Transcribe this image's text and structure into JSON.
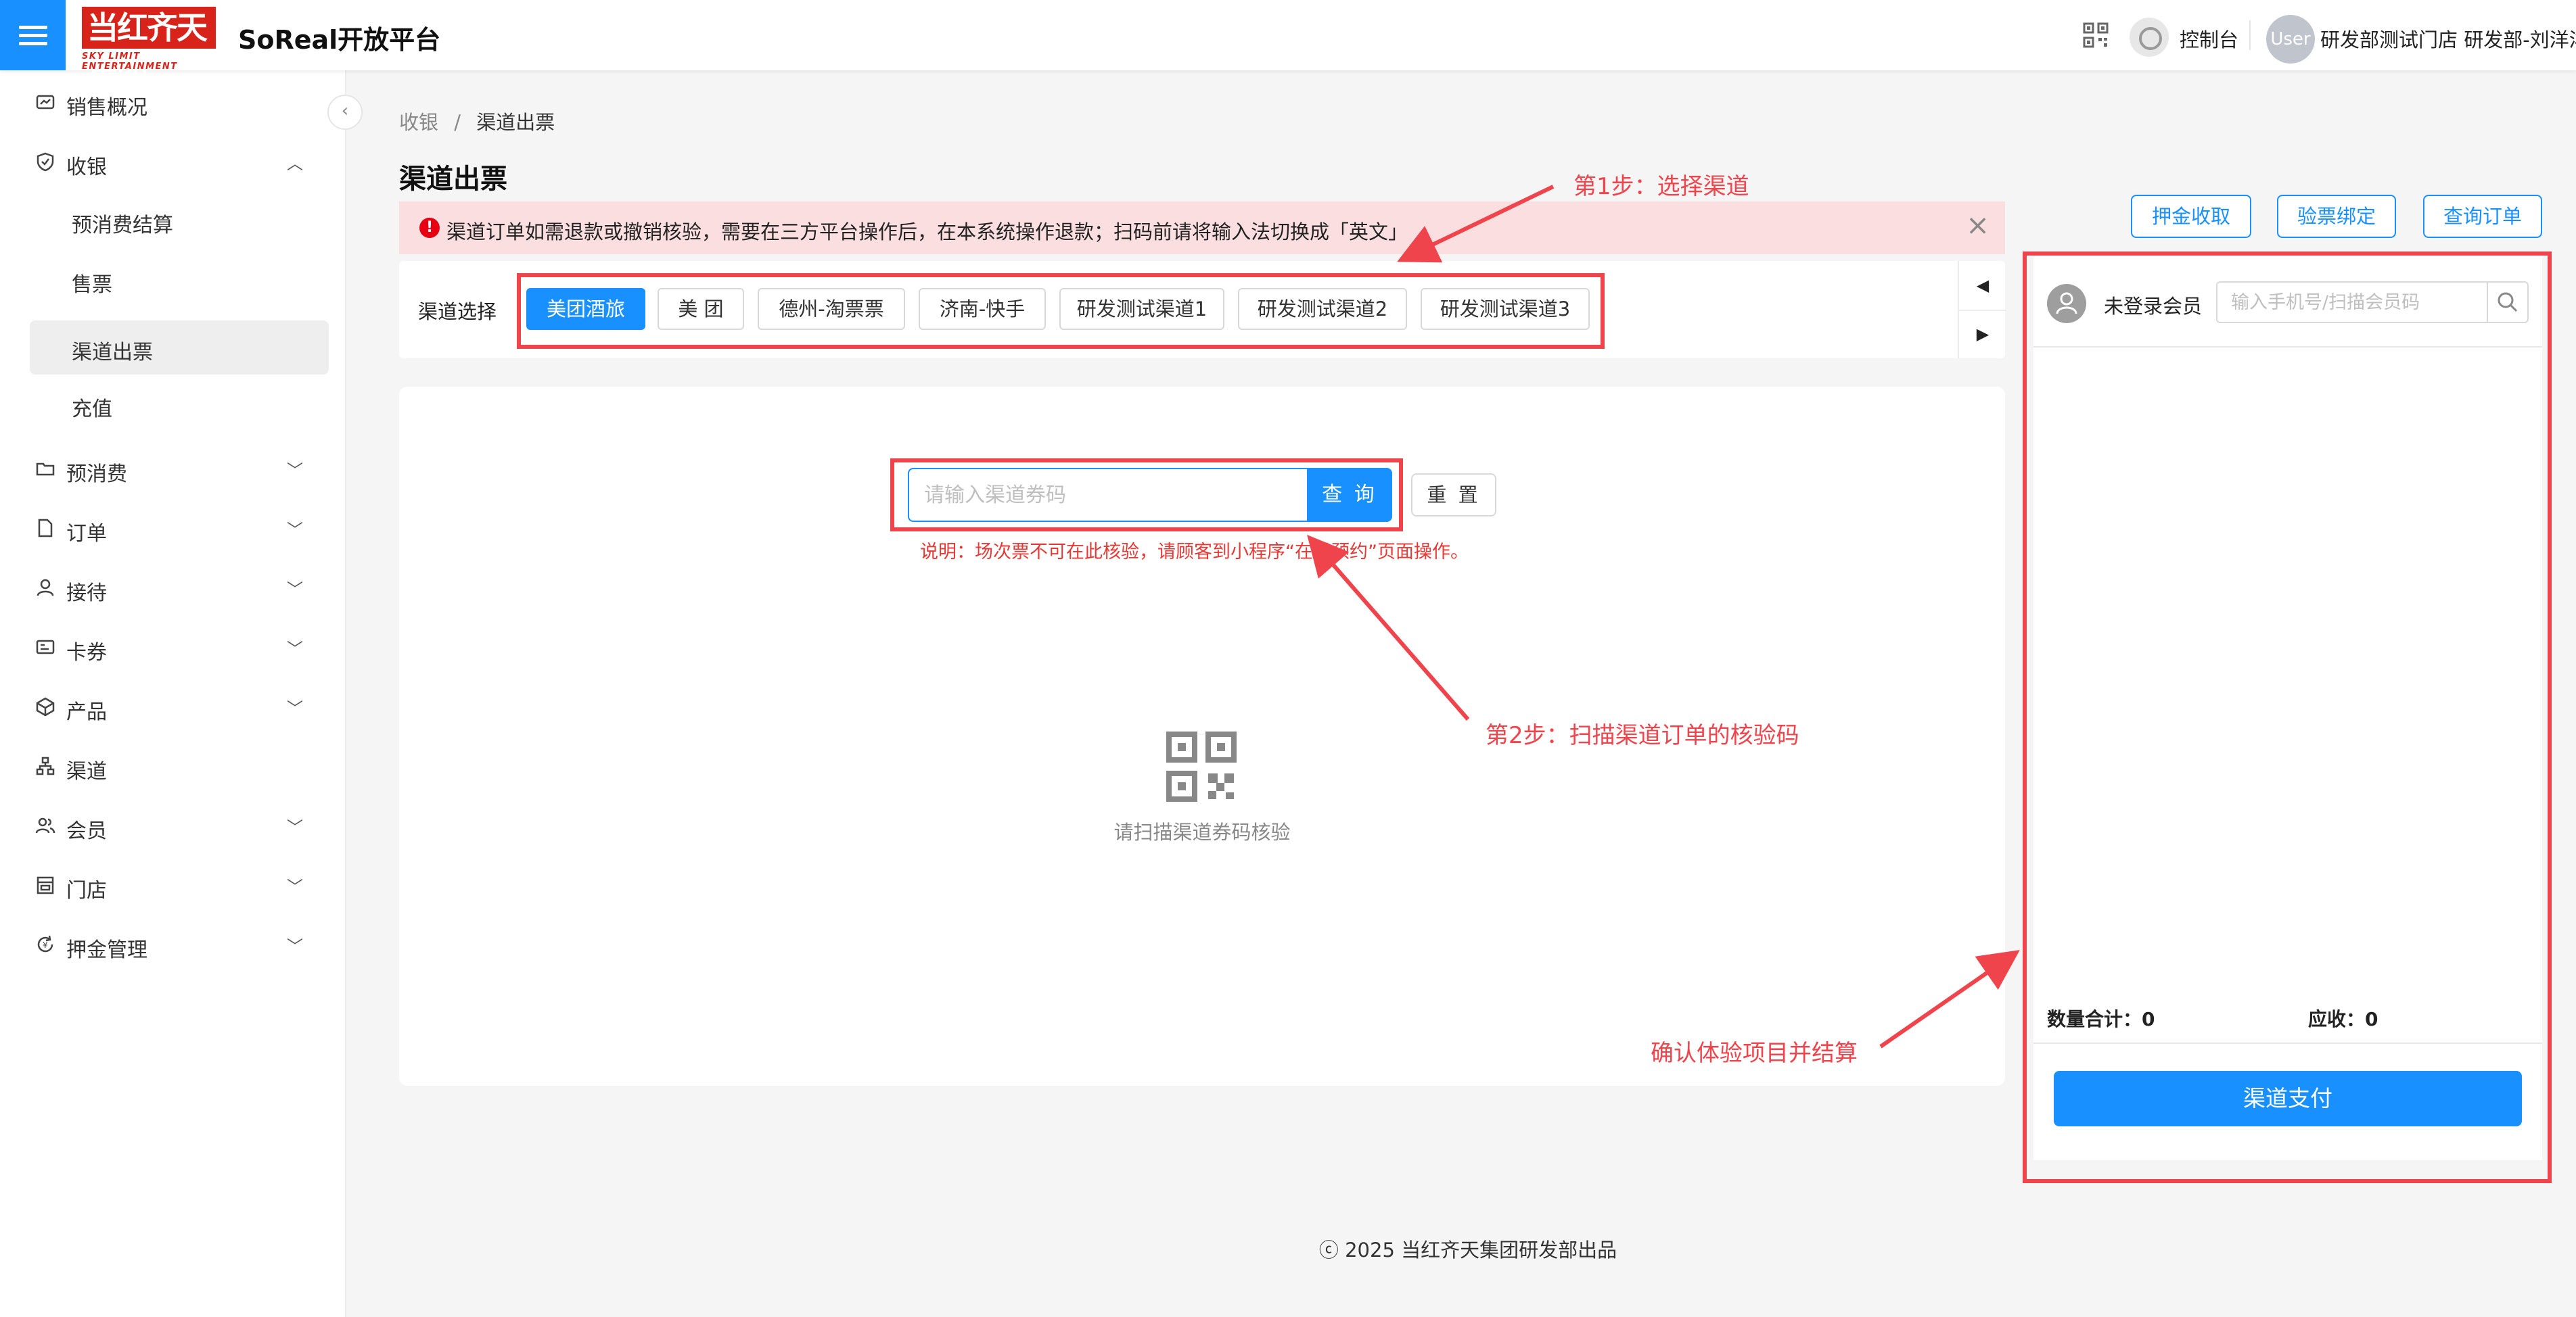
{
  "header": {
    "logo_text": "当红齐天集团",
    "logo_sub": "SKY LIMIT ENTERTAINMENT",
    "platform_title": "SoReal开放平台",
    "console_label": "控制台",
    "avatar_text": "User",
    "user_info": "研发部测试门店 研发部-刘洋洋"
  },
  "sidebar": {
    "items": [
      {
        "label": "销售概况",
        "icon": "dashboard-icon"
      },
      {
        "label": "收银",
        "icon": "shield-icon",
        "expanded": true,
        "children": [
          "预消费结算",
          "售票",
          "渠道出票",
          "充值"
        ],
        "active_child": "渠道出票"
      },
      {
        "label": "预消费",
        "icon": "folder-icon"
      },
      {
        "label": "订单",
        "icon": "document-icon"
      },
      {
        "label": "接待",
        "icon": "user-icon"
      },
      {
        "label": "卡券",
        "icon": "card-icon"
      },
      {
        "label": "产品",
        "icon": "cube-icon"
      },
      {
        "label": "渠道",
        "icon": "sitemap-icon"
      },
      {
        "label": "会员",
        "icon": "users-icon"
      },
      {
        "label": "门店",
        "icon": "store-icon"
      },
      {
        "label": "押金管理",
        "icon": "refresh-icon"
      }
    ]
  },
  "breadcrumb": {
    "parent": "收银",
    "separator": "/",
    "current": "渠道出票"
  },
  "page_title": "渠道出票",
  "alert": {
    "text": "渠道订单如需退款或撤销核验，需要在三方平台操作后，在本系统操作退款；扫码前请将输入法切换成「英文」"
  },
  "channel_select": {
    "label": "渠道选择",
    "options": [
      "美团酒旅",
      "美 团",
      "德州-淘票票",
      "济南-快手",
      "研发测试渠道1",
      "研发测试渠道2",
      "研发测试渠道3"
    ],
    "selected": "美团酒旅"
  },
  "scan": {
    "placeholder": "请输入渠道券码",
    "query_label": "查 询",
    "reset_label": "重 置",
    "note": "说明：场次票不可在此核验，请顾客到小程序“在线预约”页面操作。",
    "hint": "请扫描渠道券码核验"
  },
  "right_panel": {
    "buttons": [
      "押金收取",
      "验票绑定",
      "查询订单"
    ],
    "member_status": "未登录会员",
    "search_placeholder": "输入手机号/扫描会员码",
    "qty_label": "数量合计：",
    "qty_value": "0",
    "due_label": "应收：",
    "due_value": "0",
    "pay_label": "渠道支付"
  },
  "footer": {
    "copyright": "ⓒ 2025 当红齐天集团研发部出品"
  },
  "annotations": {
    "step1": "第1步：选择渠道",
    "step2": "第2步：扫描渠道订单的核验码",
    "step3": "确认体验项目并结算"
  },
  "colors": {
    "primary": "#1890ff",
    "brand_red": "#d7231a",
    "annotation_red": "#f0444c",
    "alert_bg": "#fbdfe0"
  }
}
